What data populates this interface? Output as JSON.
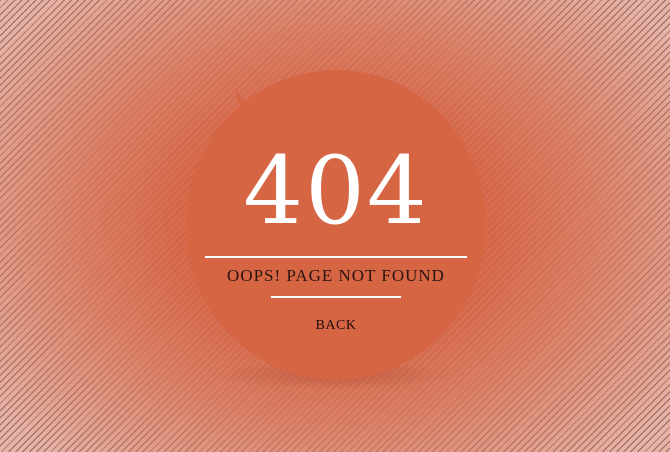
{
  "error": {
    "code": "404",
    "message": "OOPS! PAGE NOT FOUND",
    "back_label": "BACK"
  },
  "colors": {
    "bubble": "#d66544",
    "background_center": "#d96545",
    "background_edge": "#e7b3a6",
    "code_text": "#ffffff",
    "message_text": "#2a1410",
    "divider": "#ffffff"
  },
  "icons": {
    "bubble_tail": "speech-bubble-tail-icon"
  }
}
